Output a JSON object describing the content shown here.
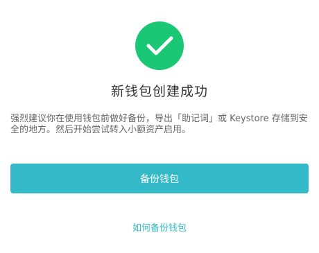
{
  "colors": {
    "success": "#19c774",
    "accent": "#33b9c8",
    "title_text": "#333333",
    "body_text": "#666666"
  },
  "icon": {
    "name": "checkmark-icon"
  },
  "title": "新钱包创建成功",
  "tip": "强烈建议你在使用钱包前做好备份，导出「助记词」或 Keystore 存储到安全的地方。然后开始尝试转入小额资产启用。",
  "backup_button_label": "备份钱包",
  "how_to_backup_link": "如何备份钱包"
}
